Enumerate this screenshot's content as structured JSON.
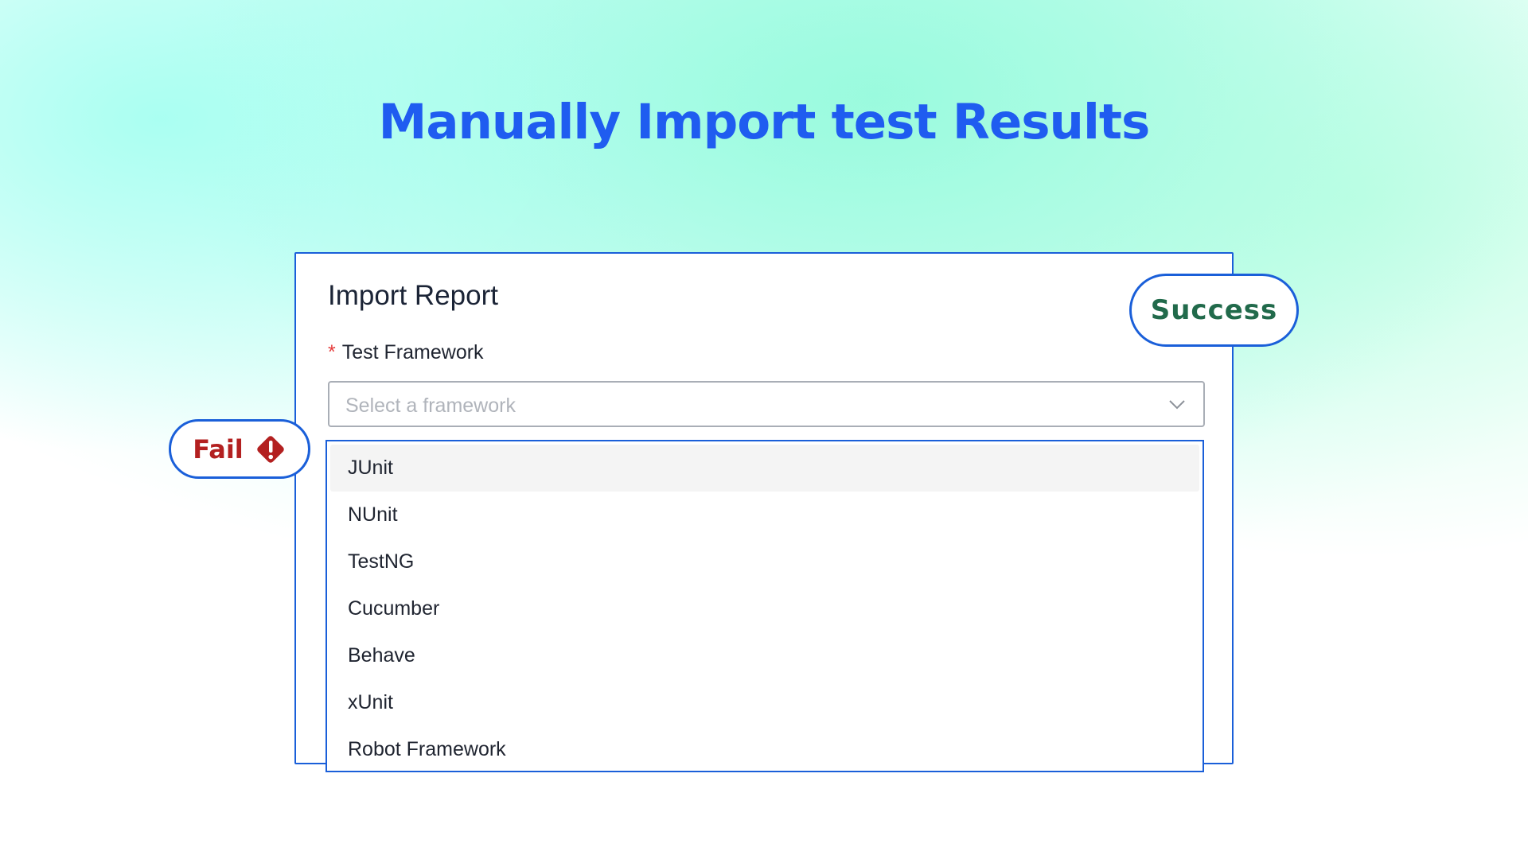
{
  "headline": "Manually Import test Results",
  "card": {
    "title": "Import Report",
    "field_required_mark": "*",
    "field_label": "Test Framework",
    "select_placeholder": "Select a framework"
  },
  "dropdown": {
    "options": [
      {
        "label": "JUnit",
        "highlighted": true
      },
      {
        "label": "NUnit",
        "highlighted": false
      },
      {
        "label": "TestNG",
        "highlighted": false
      },
      {
        "label": "Cucumber",
        "highlighted": false
      },
      {
        "label": "Behave",
        "highlighted": false
      },
      {
        "label": "xUnit",
        "highlighted": false
      },
      {
        "label": "Robot Framework",
        "highlighted": false
      }
    ]
  },
  "badges": {
    "success_label": "Success",
    "fail_label": "Fail",
    "fail_icon": "warning-diamond-icon"
  },
  "colors": {
    "headline": "#1f5cf0",
    "accent_border": "#1a5fd9",
    "success_text": "#216a4b",
    "fail_text": "#b32020",
    "required_mark": "#e53b3b"
  }
}
